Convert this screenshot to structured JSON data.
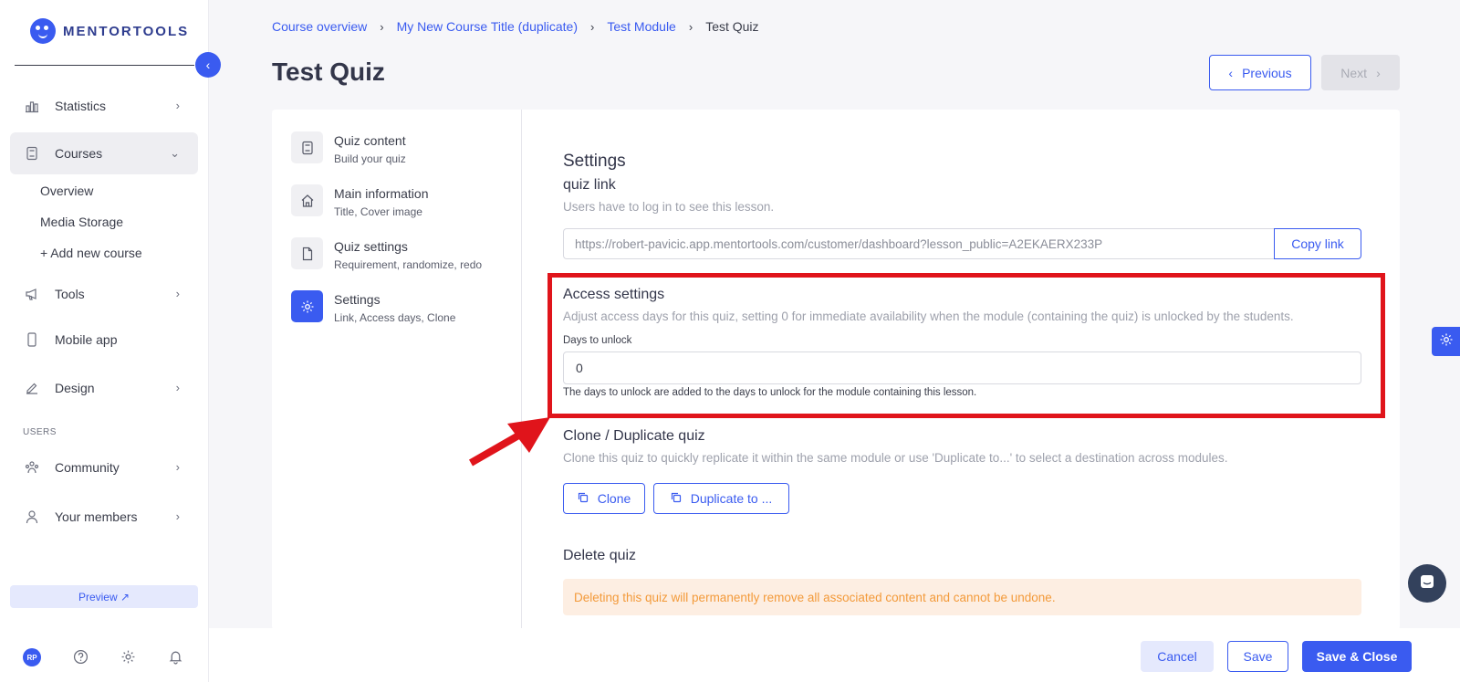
{
  "brand": {
    "name": "MENTORTOOLS"
  },
  "sidebar": {
    "items": [
      {
        "label": "Statistics"
      },
      {
        "label": "Courses"
      },
      {
        "label": "Tools"
      },
      {
        "label": "Mobile app"
      },
      {
        "label": "Design"
      },
      {
        "label": "Community"
      },
      {
        "label": "Your members"
      }
    ],
    "sub_items": [
      "Overview",
      "Media Storage",
      "+ Add new course"
    ],
    "section_label": "USERS",
    "preview_label": "Preview ↗",
    "avatar_initials": "RP"
  },
  "breadcrumb": [
    "Course overview",
    "My New Course Title (duplicate)",
    "Test Module",
    "Test Quiz"
  ],
  "page": {
    "title": "Test Quiz",
    "prev_label": "Previous",
    "next_label": "Next"
  },
  "steps": [
    {
      "title": "Quiz content",
      "desc": "Build your quiz"
    },
    {
      "title": "Main information",
      "desc": "Title, Cover image"
    },
    {
      "title": "Quiz settings",
      "desc": "Requirement, randomize, redo"
    },
    {
      "title": "Settings",
      "desc": "Link, Access days, Clone"
    }
  ],
  "settings": {
    "heading": "Settings",
    "quiz_link": {
      "title": "quiz link",
      "desc": "Users have to log in to see this lesson.",
      "url": "https://robert-pavicic.app.mentortools.com/customer/dashboard?lesson_public=A2EKAERX233P",
      "copy_label": "Copy link"
    },
    "access": {
      "title": "Access settings",
      "desc": "Adjust access days for this quiz, setting 0 for immediate availability when the module (containing the quiz) is unlocked by the students.",
      "field_label": "Days to unlock",
      "value": "0",
      "help": "The days to unlock are added to the days to unlock for the module containing this lesson."
    },
    "clone": {
      "title": "Clone / Duplicate quiz",
      "desc": "Clone this quiz to quickly replicate it within the same module or use 'Duplicate to...' to select a destination across modules.",
      "clone_label": "Clone",
      "duplicate_label": "Duplicate to ..."
    },
    "delete": {
      "title": "Delete quiz",
      "warning": "Deleting this quiz will permanently remove all associated content and cannot be undone."
    }
  },
  "footer": {
    "cancel_label": "Cancel",
    "save_label": "Save",
    "save_close_label": "Save & Close"
  },
  "colors": {
    "accent": "#3a5bf0",
    "highlight": "#e0141b",
    "warning_text": "#f39a3a",
    "warning_bg": "#fdeee2"
  }
}
